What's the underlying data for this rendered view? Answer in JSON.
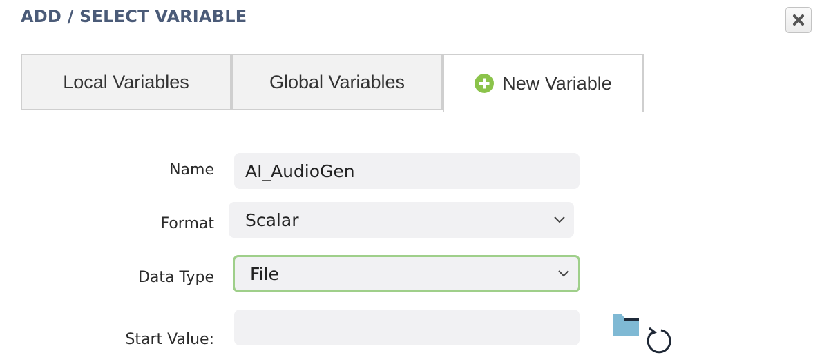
{
  "dialog": {
    "title": "ADD / SELECT VARIABLE",
    "close_icon": "close-x-icon"
  },
  "tabs": [
    {
      "label": "Local Variables",
      "active": false
    },
    {
      "label": "Global Variables",
      "active": false
    },
    {
      "label": "New Variable",
      "active": true,
      "icon": "plus-circle-icon"
    }
  ],
  "form": {
    "name_label": "Name",
    "name_value": "AI_AudioGen",
    "format_label": "Format",
    "format_value": "Scalar",
    "data_type_label": "Data Type",
    "data_type_value": "File",
    "start_value_label": "Start Value:",
    "start_value_value": "",
    "browse_icon": "folder-icon",
    "reset_icon": "refresh-icon"
  },
  "colors": {
    "title": "#4b5b78",
    "accent_green": "#8bc34a",
    "focus_border": "#9fcf8a",
    "folder": "#7fb9d4",
    "field_bg": "#f1f1f3"
  }
}
